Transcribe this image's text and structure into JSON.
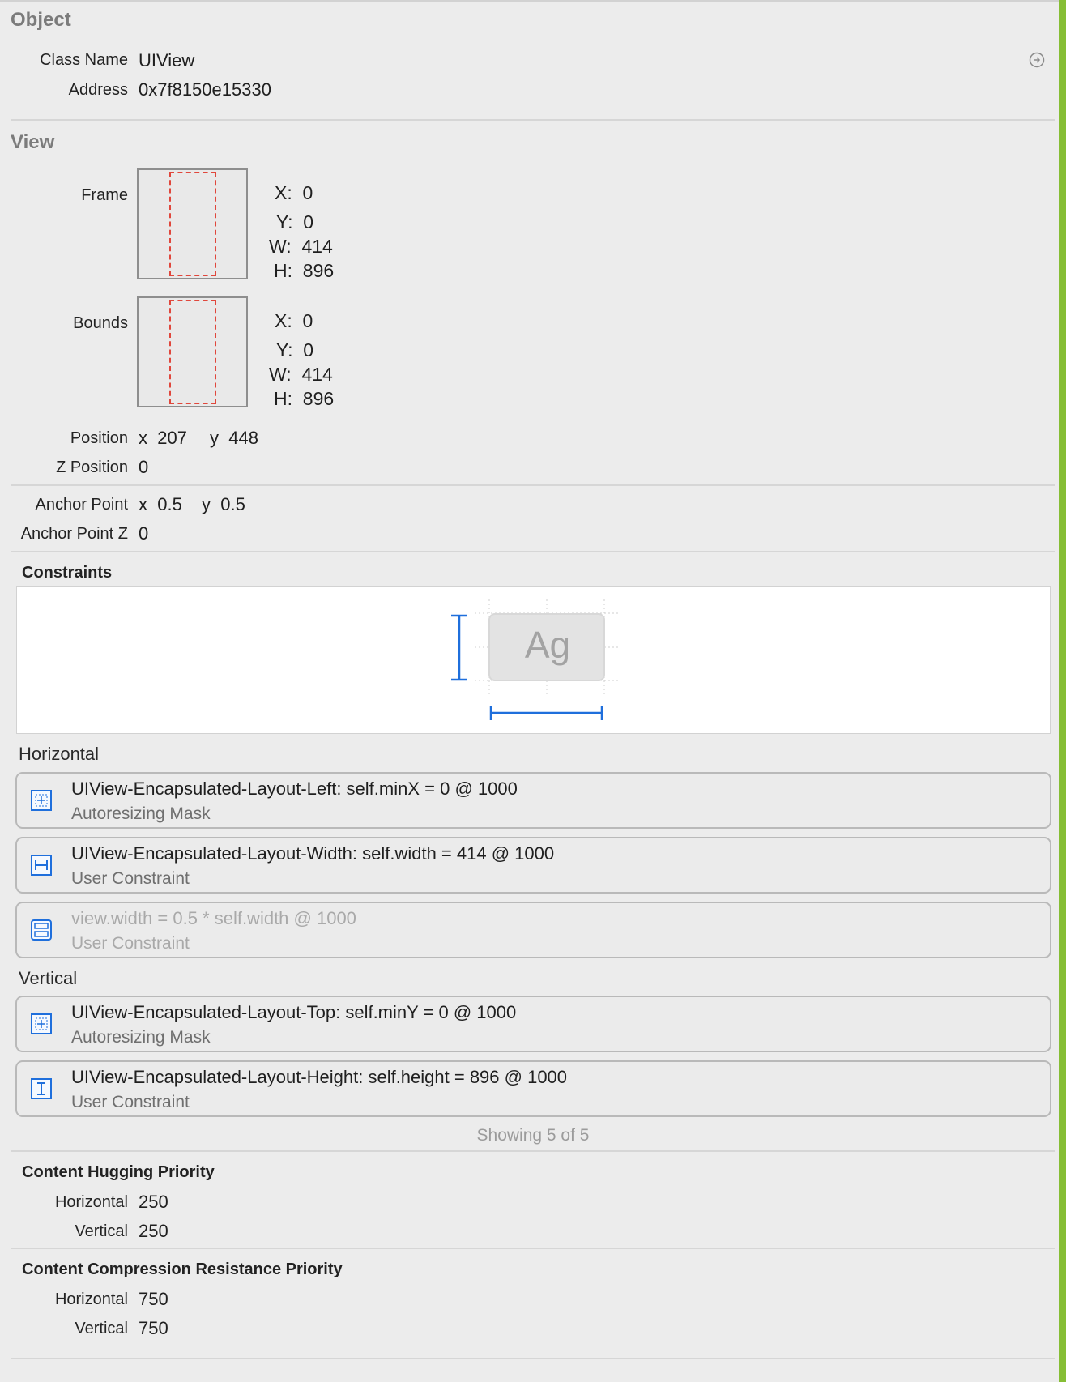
{
  "object": {
    "title": "Object",
    "class_name_label": "Class Name",
    "class_name_value": "UIView",
    "address_label": "Address",
    "address_value": "0x7f8150e15330"
  },
  "view": {
    "title": "View",
    "frame": {
      "label": "Frame",
      "x": "X:  0",
      "y": "Y:  0",
      "w": "W:  414",
      "h": "H:  896"
    },
    "bounds": {
      "label": "Bounds",
      "x": "X:  0",
      "y": "Y:  0",
      "w": "W:  414",
      "h": "H:  896"
    },
    "position_label": "Position",
    "position_x": "x  207",
    "position_y": "y  448",
    "z_position_label": "Z Position",
    "z_position_value": "0",
    "anchor_point_label": "Anchor Point",
    "anchor_point_x": "x  0.5",
    "anchor_point_y": "y  0.5",
    "anchor_point_z_label": "Anchor Point Z",
    "anchor_point_z_value": "0"
  },
  "constraints": {
    "title": "Constraints",
    "preview_text": "Ag",
    "horizontal_label": "Horizontal",
    "vertical_label": "Vertical",
    "horizontal": [
      {
        "title": "UIView-Encapsulated-Layout-Left: self.minX = 0 @ 1000",
        "subtitle": "Autoresizing Mask",
        "icon": "autoresizing-mask-icon"
      },
      {
        "title": "UIView-Encapsulated-Layout-Width: self.width = 414 @ 1000",
        "subtitle": "User Constraint",
        "icon": "width-constraint-icon"
      },
      {
        "title": "view.width = 0.5 * self.width @ 1000",
        "subtitle": "User Constraint",
        "icon": "equal-widths-icon"
      }
    ],
    "vertical": [
      {
        "title": "UIView-Encapsulated-Layout-Top: self.minY = 0 @ 1000",
        "subtitle": "Autoresizing Mask",
        "icon": "autoresizing-mask-icon"
      },
      {
        "title": "UIView-Encapsulated-Layout-Height: self.height = 896 @ 1000",
        "subtitle": "User Constraint",
        "icon": "height-constraint-icon"
      }
    ],
    "showing": "Showing 5 of 5"
  },
  "hugging": {
    "title": "Content Hugging Priority",
    "horizontal_label": "Horizontal",
    "horizontal_value": "250",
    "vertical_label": "Vertical",
    "vertical_value": "250"
  },
  "compression": {
    "title": "Content Compression Resistance Priority",
    "horizontal_label": "Horizontal",
    "horizontal_value": "750",
    "vertical_label": "Vertical",
    "vertical_value": "750"
  },
  "colors": {
    "accent_bar": "#86be35",
    "constraint_blue": "#1f6fdc",
    "frame_dash": "#e0473c"
  }
}
